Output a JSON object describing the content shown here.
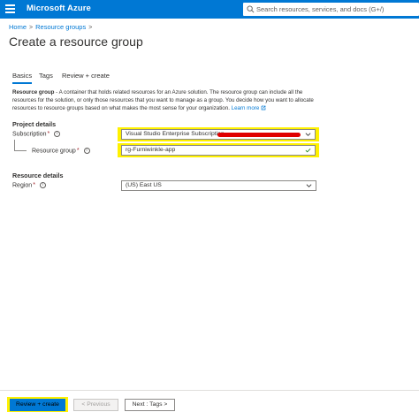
{
  "header": {
    "brand": "Microsoft Azure",
    "search_placeholder": "Search resources, services, and docs (G+/)"
  },
  "breadcrumb": {
    "items": [
      "Home",
      "Resource groups"
    ]
  },
  "page": {
    "title": "Create a resource group",
    "more": "···"
  },
  "tabs": [
    {
      "label": "Basics",
      "selected": true
    },
    {
      "label": "Tags",
      "selected": false
    },
    {
      "label": "Review + create",
      "selected": false
    }
  ],
  "description": {
    "term": "Resource group",
    "text": " - A container that holds related resources for an Azure solution. The resource group can include all the resources for the solution, or only those resources that you want to manage as a group. You decide how you want to allocate resources to resource groups based on what makes the most sense for your organization. ",
    "link": "Learn more"
  },
  "project_details": {
    "header": "Project details",
    "subscription": {
      "label": "Subscription",
      "required": "*",
      "value": "Visual Studio Enterprise Subscription"
    },
    "resource_group": {
      "label": "Resource group",
      "required": "*",
      "value": "rg-Furniwinkle-app"
    }
  },
  "resource_details": {
    "header": "Resource details",
    "region": {
      "label": "Region",
      "required": "*",
      "value": "(US) East US"
    }
  },
  "footer": {
    "review_create": "Review + create",
    "previous": "< Previous",
    "next": "Next : Tags >"
  },
  "colors": {
    "accent": "#0078d4",
    "highlight": "#fff100",
    "redaction": "#e00000"
  }
}
